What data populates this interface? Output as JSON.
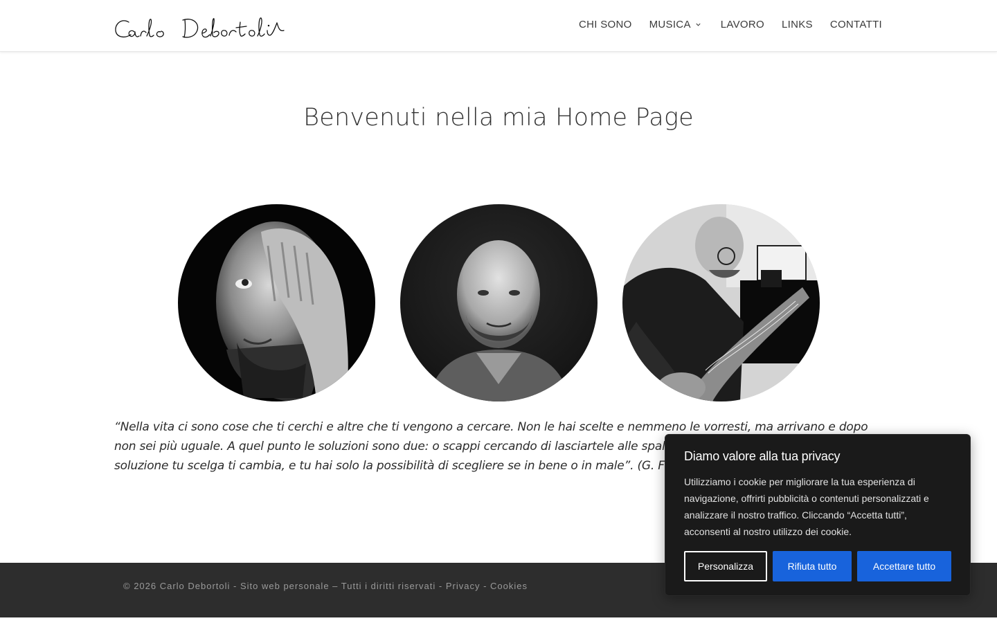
{
  "header": {
    "logo_text": "Carlo Debortoli",
    "nav": [
      {
        "label": "CHI SONO"
      },
      {
        "label": "MUSICA",
        "has_dropdown": true
      },
      {
        "label": "LAVORO"
      },
      {
        "label": "LINKS"
      },
      {
        "label": "CONTATTI"
      }
    ]
  },
  "main": {
    "title": "Benvenuti nella mia Home Page",
    "photos": [
      {
        "subject": "portrait-hand-over-eye"
      },
      {
        "subject": "portrait-smiling"
      },
      {
        "subject": "portrait-playing-bass"
      }
    ],
    "quote": "“Nella vita ci sono cose che ti cerchi e altre che ti vengono a cercare. Non le hai scelte e nemmeno le vorresti, ma arrivano e dopo non sei più uguale. A quel punto le soluzioni sono due: o scappi cercando di lasciartele alle spalle o ti fermi e le affronti. Qualsiasi soluzione tu scelga ti cambia, e tu hai solo la possibilità di scegliere se in bene o in male”. (G. Falcone)"
  },
  "footer": {
    "copyright": "© 2026 Carlo Debortoli - Sito web personale – Tutti i diritti riservati",
    "separator": " - ",
    "privacy": "Privacy",
    "dash": " - ",
    "cookies": "Cookies"
  },
  "cookie_banner": {
    "title": "Diamo valore alla tua privacy",
    "body": "Utilizziamo i cookie per migliorare la tua esperienza di navigazione, offrirti pubblicità o contenuti personalizzati e analizzare il nostro traffico. Cliccando “Accetta tutti”, acconsenti al nostro utilizzo dei cookie.",
    "customize_label": "Personalizza",
    "reject_label": "Rifiuta tutto",
    "accept_label": "Accettare tutto",
    "button_color": "#1863dc"
  }
}
